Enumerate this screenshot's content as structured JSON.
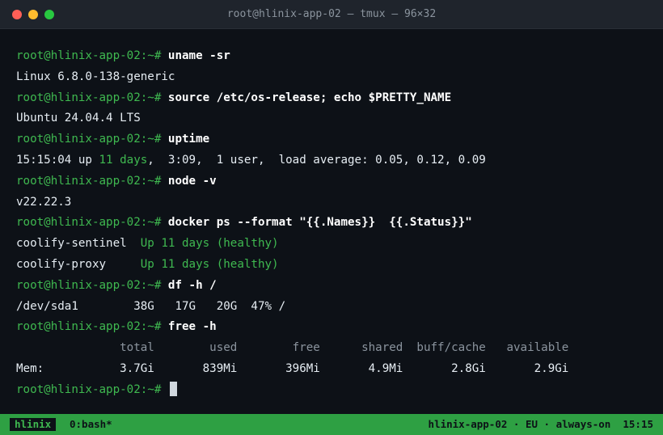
{
  "window": {
    "title": "root@hlinix-app-02 — tmux — 96×32"
  },
  "prompt": "root@hlinix-app-02:~#",
  "lines": [
    {
      "kind": "cmd",
      "text": "uname -sr"
    },
    {
      "kind": "out",
      "text": "Linux 6.8.0-138-generic"
    },
    {
      "kind": "cmd",
      "text": "source /etc/os-release; echo $PRETTY_NAME"
    },
    {
      "kind": "out",
      "text": "Ubuntu 24.04.4 LTS"
    },
    {
      "kind": "cmd",
      "text": "uptime"
    },
    {
      "kind": "uptime",
      "a": "15:15:04 up ",
      "b": "11 days",
      "c": ",  3:09,  1 user,  load average: 0.05, 0.12, 0.09"
    },
    {
      "kind": "cmd",
      "text": "node -v"
    },
    {
      "kind": "out",
      "text": "v22.22.3"
    },
    {
      "kind": "cmd",
      "text": "docker ps --format \"{{.Names}}  {{.Status}}\""
    },
    {
      "kind": "docker",
      "name": "coolify-sentinel  ",
      "status": "Up 11 days (healthy)"
    },
    {
      "kind": "docker",
      "name": "coolify-proxy     ",
      "status": "Up 11 days (healthy)"
    },
    {
      "kind": "cmd",
      "text": "df -h /"
    },
    {
      "kind": "out",
      "text": "/dev/sda1        38G   17G   20G  47% /"
    },
    {
      "kind": "cmd",
      "text": "free -h"
    },
    {
      "kind": "head",
      "text": "               total        used        free      shared  buff/cache   available"
    },
    {
      "kind": "out",
      "text": "Mem:           3.7Gi       839Mi       396Mi       4.9Mi       2.8Gi       2.9Gi"
    },
    {
      "kind": "cursor"
    }
  ],
  "status": {
    "session": "hlinix",
    "window": "0:bash*",
    "right": "hlinix-app-02 · EU · always-on  15:15"
  }
}
